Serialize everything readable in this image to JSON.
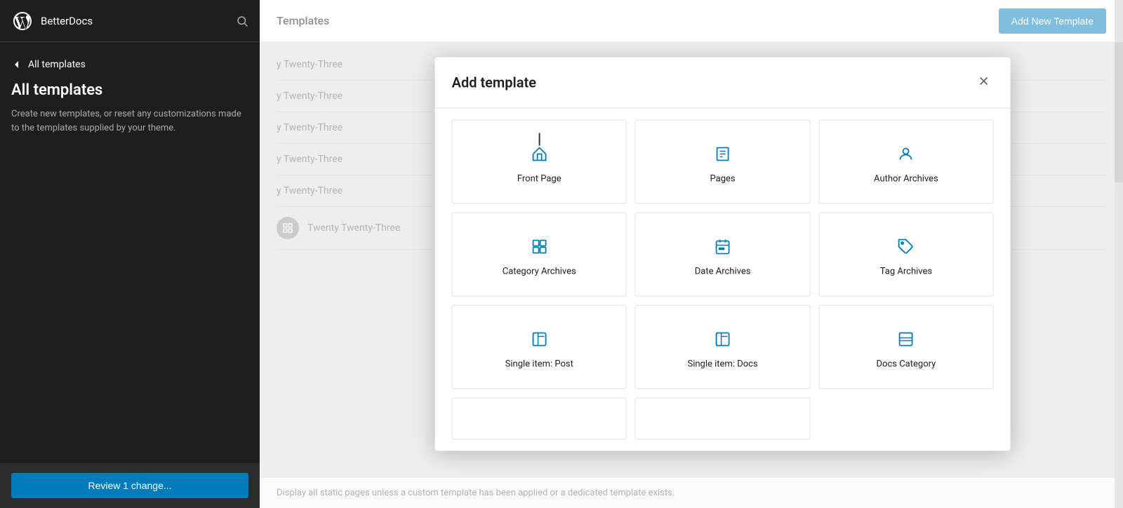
{
  "sidebar": {
    "logo_alt": "WordPress",
    "app_name": "BetterDocs",
    "back_label": "All templates",
    "title": "All templates",
    "description": "Create new templates, or reset any customizations made to the templates supplied by your theme.",
    "review_button": "Review 1 change..."
  },
  "main": {
    "title": "Templates",
    "add_new_button": "Add New Template",
    "background_rows": [
      {
        "label": "y Twenty-Three"
      },
      {
        "label": "y Twenty-Three"
      },
      {
        "label": "y Twenty-Three"
      },
      {
        "label": "y Twenty-Three"
      },
      {
        "label": "y Twenty-Three"
      },
      {
        "label": "y Twenty-Three"
      }
    ],
    "desc_bar": "Display all static pages unless a custom template has been applied or a dedicated template exists."
  },
  "modal": {
    "title": "Add template",
    "close_label": "×",
    "templates": [
      {
        "id": "front-page",
        "label": "Front Page",
        "icon": "home"
      },
      {
        "id": "pages",
        "label": "Pages",
        "icon": "pages"
      },
      {
        "id": "author-archives",
        "label": "Author Archives",
        "icon": "author"
      },
      {
        "id": "category-archives",
        "label": "Category Archives",
        "icon": "grid"
      },
      {
        "id": "date-archives",
        "label": "Date Archives",
        "icon": "calendar"
      },
      {
        "id": "tag-archives",
        "label": "Tag Archives",
        "icon": "tag"
      },
      {
        "id": "single-post",
        "label": "Single item: Post",
        "icon": "layout"
      },
      {
        "id": "single-docs",
        "label": "Single item: Docs",
        "icon": "layout"
      },
      {
        "id": "docs-category",
        "label": "Docs Category",
        "icon": "layout-alt"
      }
    ]
  }
}
